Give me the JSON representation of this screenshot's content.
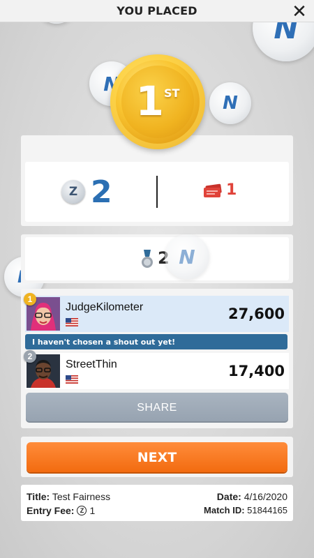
{
  "header": {
    "title": "YOU PLACED",
    "close_icon": "close-icon"
  },
  "placement": {
    "rank": "1",
    "suffix": "ST"
  },
  "rewards": {
    "z_coins": "2",
    "tickets": "1",
    "xp": "2"
  },
  "players": [
    {
      "rank": "1",
      "name": "JudgeKilometer",
      "country": "US",
      "score": "27,600",
      "highlight": true
    },
    {
      "rank": "2",
      "name": "StreetThin",
      "country": "US",
      "score": "17,400",
      "highlight": false
    }
  ],
  "shout_out": "I haven't chosen a shout out yet!",
  "buttons": {
    "share": "SHARE",
    "next": "NEXT"
  },
  "match_info": {
    "title_label": "Title:",
    "title_value": "Test Fairness",
    "fee_label": "Entry Fee:",
    "fee_value": "1",
    "date_label": "Date:",
    "date_value": "4/16/2020",
    "match_label": "Match ID:",
    "match_value": "51844165"
  },
  "colors": {
    "accent_blue": "#2b6fb3",
    "next_orange": "#f27a22",
    "ticket_red": "#e0433a",
    "gold": "#f0b320"
  }
}
